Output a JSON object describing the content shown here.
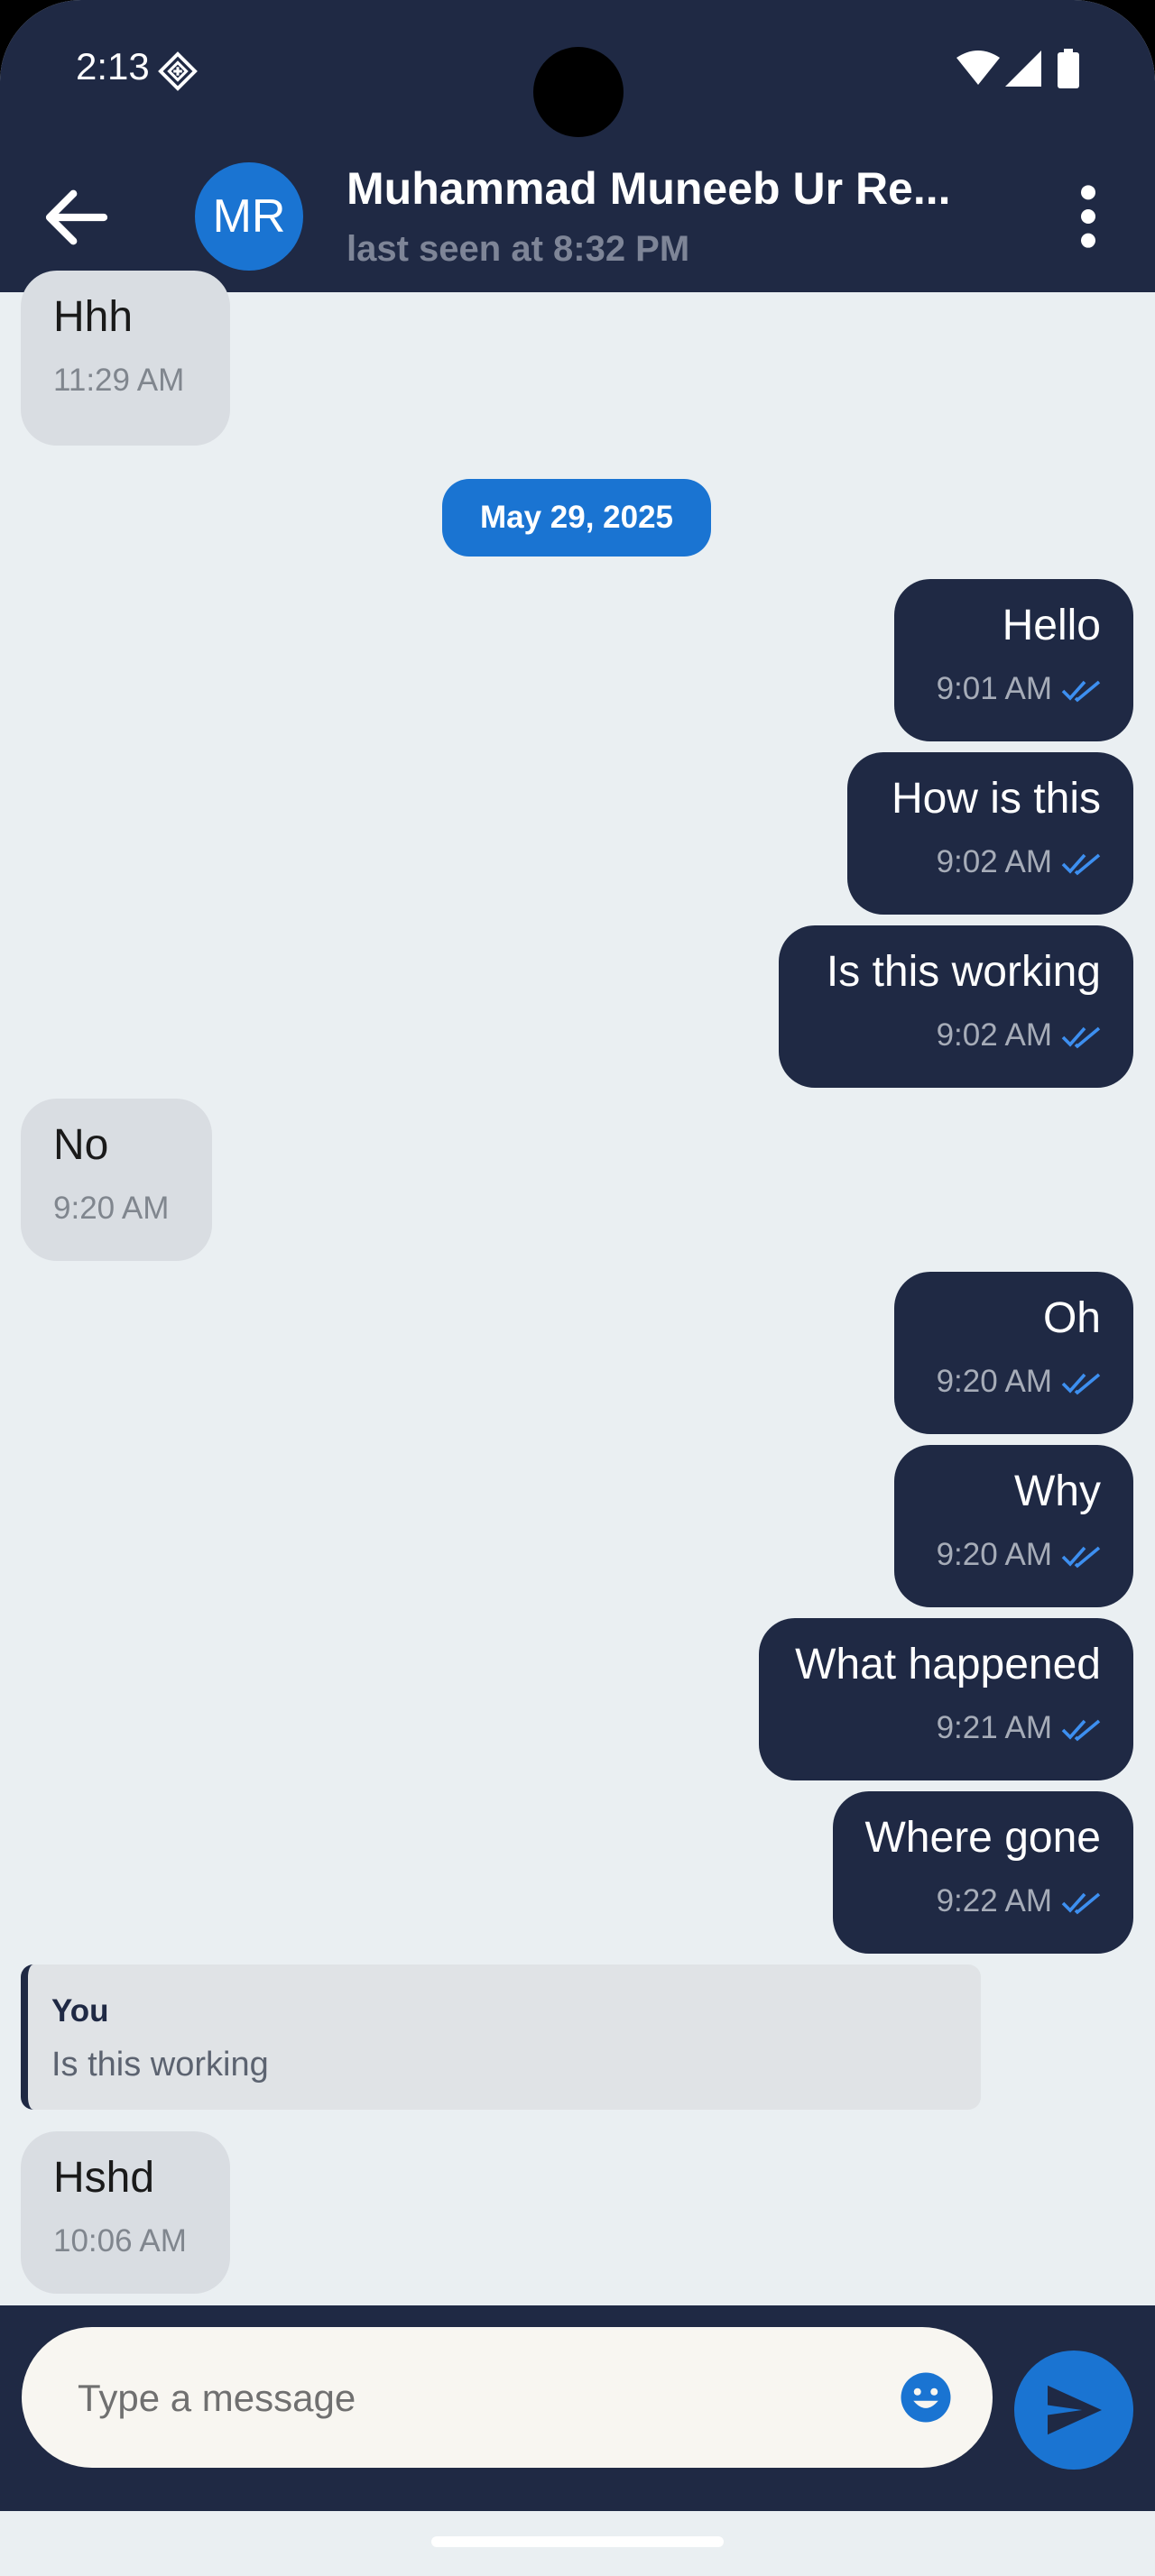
{
  "status_bar": {
    "time": "2:13"
  },
  "header": {
    "avatar_initials": "MR",
    "contact_name": "Muhammad Muneeb Ur Re...",
    "last_seen": "last seen at 8:32 PM"
  },
  "messages": [
    {
      "direction": "in",
      "text": "Hhh",
      "time": "11:29 AM"
    },
    {
      "date_separator": "May 29, 2025"
    },
    {
      "direction": "out",
      "text": "Hello",
      "time": "9:01 AM",
      "read": true
    },
    {
      "direction": "out",
      "text": "How is this",
      "time": "9:02 AM",
      "read": true
    },
    {
      "direction": "out",
      "text": "Is this working",
      "time": "9:02 AM",
      "read": true
    },
    {
      "direction": "in",
      "text": "No",
      "time": "9:20 AM"
    },
    {
      "direction": "out",
      "text": "Oh",
      "time": "9:20 AM",
      "read": true
    },
    {
      "direction": "out",
      "text": "Why",
      "time": "9:20 AM",
      "read": true
    },
    {
      "direction": "out",
      "text": "What happened",
      "time": "9:21 AM",
      "read": true
    },
    {
      "direction": "out",
      "text": "Where gone",
      "time": "9:22 AM",
      "read": true
    },
    {
      "reply_to": {
        "author": "You",
        "text": "Is this working"
      }
    },
    {
      "direction": "in",
      "text": "Hshd",
      "time": "10:06 AM"
    }
  ],
  "composer": {
    "placeholder": "Type a message"
  },
  "colors": {
    "header_bg": "#1f2944",
    "chat_bg": "#eaeff2",
    "incoming_bubble": "#d9dde2",
    "outgoing_bubble": "#1f2944",
    "accent": "#1a74d2",
    "read_tick": "#3d8ff0"
  },
  "icons": [
    "back-arrow-icon",
    "more-vert-icon",
    "wifi-icon",
    "signal-icon",
    "battery-icon",
    "double-check-icon",
    "emoji-icon",
    "send-icon"
  ]
}
